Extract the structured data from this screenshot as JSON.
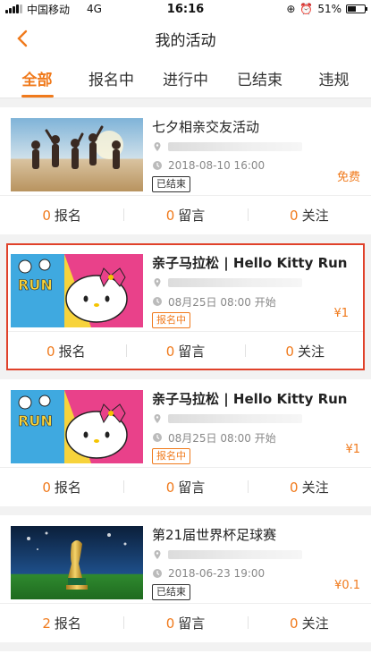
{
  "status_bar": {
    "carrier": "中国移动",
    "network": "4G",
    "time": "16:16",
    "battery": "51%",
    "battery_level": 0.51
  },
  "nav": {
    "title": "我的活动"
  },
  "tabs": [
    {
      "label": "全部",
      "active": true
    },
    {
      "label": "报名中",
      "active": false
    },
    {
      "label": "进行中",
      "active": false
    },
    {
      "label": "已结束",
      "active": false
    },
    {
      "label": "违规",
      "active": false
    }
  ],
  "activities": [
    {
      "title": "七夕相亲交友活动",
      "time": "2018-08-10 16:00",
      "status": "已结束",
      "price": "免费",
      "signups": "0",
      "signups_label": "报名",
      "comments": "0",
      "comments_label": "留言",
      "follows": "0",
      "follows_label": "关注"
    },
    {
      "title": "亲子马拉松 | Hello Kitty Run",
      "time": "08月25日 08:00 开始",
      "status": "报名中",
      "price": "¥1",
      "signups": "0",
      "signups_label": "报名",
      "comments": "0",
      "comments_label": "留言",
      "follows": "0",
      "follows_label": "关注"
    },
    {
      "title": "亲子马拉松 | Hello Kitty Run",
      "time": "08月25日 08:00 开始",
      "status": "报名中",
      "price": "¥1",
      "signups": "0",
      "signups_label": "报名",
      "comments": "0",
      "comments_label": "留言",
      "follows": "0",
      "follows_label": "关注"
    },
    {
      "title": "第21届世界杯足球赛",
      "time": "2018-06-23 19:00",
      "status": "已结束",
      "price": "¥0.1",
      "signups": "2",
      "signups_label": "报名",
      "comments": "0",
      "comments_label": "留言",
      "follows": "0",
      "follows_label": "关注"
    }
  ]
}
